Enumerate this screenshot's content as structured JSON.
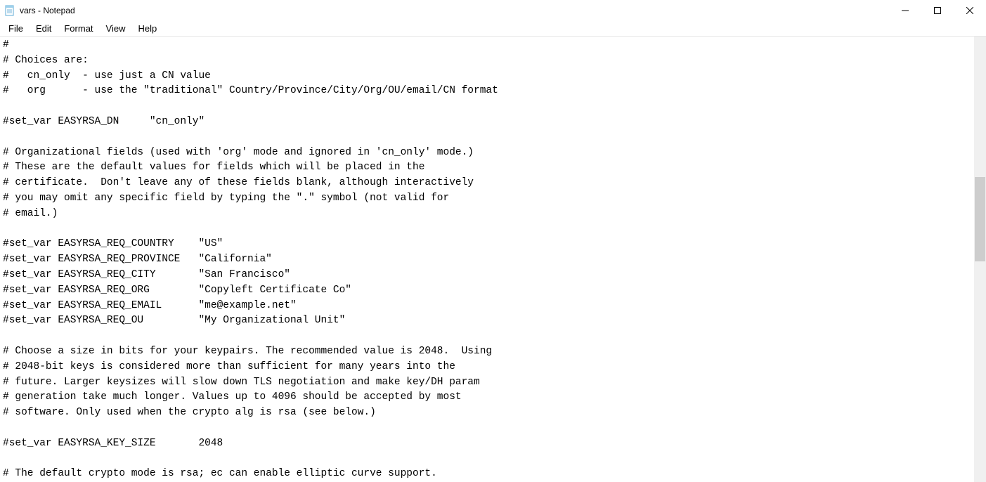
{
  "window": {
    "title": "vars - Notepad"
  },
  "menu": {
    "file": "File",
    "edit": "Edit",
    "format": "Format",
    "view": "View",
    "help": "Help"
  },
  "editor": {
    "content": "#\n# Choices are:\n#   cn_only  - use just a CN value\n#   org      - use the \"traditional\" Country/Province/City/Org/OU/email/CN format\n\n#set_var EASYRSA_DN     \"cn_only\"\n\n# Organizational fields (used with 'org' mode and ignored in 'cn_only' mode.)\n# These are the default values for fields which will be placed in the\n# certificate.  Don't leave any of these fields blank, although interactively\n# you may omit any specific field by typing the \".\" symbol (not valid for\n# email.)\n\n#set_var EASYRSA_REQ_COUNTRY    \"US\"\n#set_var EASYRSA_REQ_PROVINCE   \"California\"\n#set_var EASYRSA_REQ_CITY       \"San Francisco\"\n#set_var EASYRSA_REQ_ORG        \"Copyleft Certificate Co\"\n#set_var EASYRSA_REQ_EMAIL      \"me@example.net\"\n#set_var EASYRSA_REQ_OU         \"My Organizational Unit\"\n\n# Choose a size in bits for your keypairs. The recommended value is 2048.  Using\n# 2048-bit keys is considered more than sufficient for many years into the\n# future. Larger keysizes will slow down TLS negotiation and make key/DH param\n# generation take much longer. Values up to 4096 should be accepted by most\n# software. Only used when the crypto alg is rsa (see below.)\n\n#set_var EASYRSA_KEY_SIZE       2048\n\n# The default crypto mode is rsa; ec can enable elliptic curve support."
  }
}
